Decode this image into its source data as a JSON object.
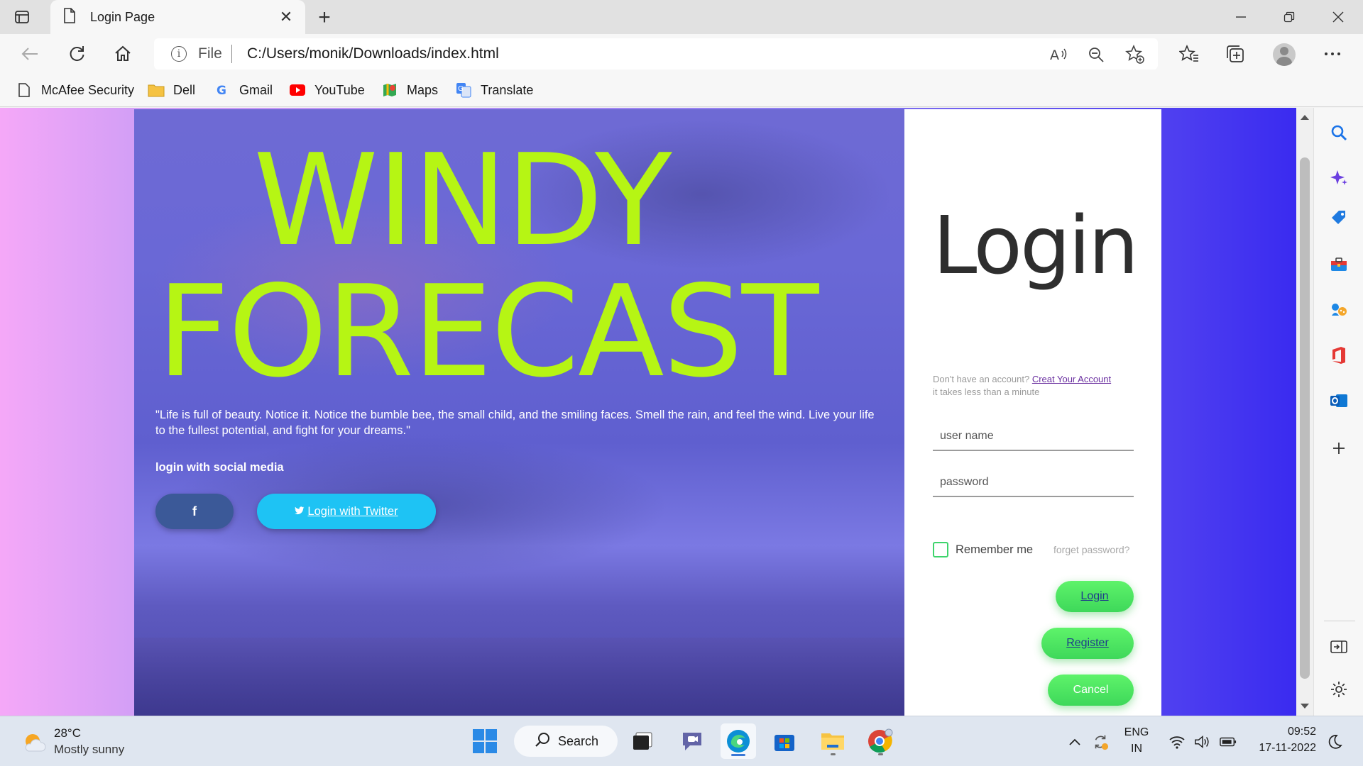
{
  "browser": {
    "tab_title": "Login Page",
    "address_scheme": "File",
    "address_url": "C:/Users/monik/Downloads/index.html",
    "bookmarks": [
      {
        "label": "McAfee Security",
        "icon": "page-icon"
      },
      {
        "label": "Dell",
        "icon": "folder-icon"
      },
      {
        "label": "Gmail",
        "icon": "google-icon"
      },
      {
        "label": "YouTube",
        "icon": "youtube-icon"
      },
      {
        "label": "Maps",
        "icon": "maps-icon"
      },
      {
        "label": "Translate",
        "icon": "translate-icon"
      }
    ]
  },
  "hero": {
    "headline_line1": "WINDY",
    "headline_line2": "FORECAST",
    "quote": "\"Life is full of beauty. Notice it. Notice the bumble bee, the small child, and the smiling faces. Smell the rain, and feel the wind. Live your life to the fullest potential, and fight for your dreams.\"",
    "social_label": "login with social media",
    "facebook_label": "f",
    "twitter_label": "Login with Twitter"
  },
  "login": {
    "title": "Login",
    "no_account_text": "Don't have an account?",
    "create_account_link": "Creat Your Account",
    "takes_less_text": "it takes less than a minute",
    "username_placeholder": "user name",
    "password_placeholder": "password",
    "remember_label": "Remember me",
    "forgot_label": "forget password?",
    "login_button": "Login",
    "register_button": "Register",
    "cancel_button": "Cancel"
  },
  "taskbar": {
    "weather_temp": "28°C",
    "weather_desc": "Mostly sunny",
    "search_label": "Search",
    "language_line1": "ENG",
    "language_line2": "IN",
    "time": "09:52",
    "date": "17-11-2022"
  },
  "colors": {
    "headline": "#b6f514",
    "accent_green": "#3ed85a",
    "twitter_blue": "#1ec3f4",
    "facebook_blue": "#3b5998"
  }
}
